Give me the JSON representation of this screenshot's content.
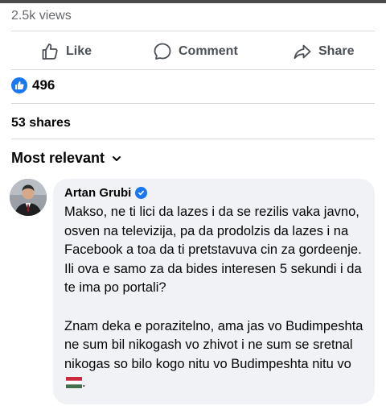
{
  "post": {
    "views": "2.5k views",
    "actions": {
      "like_label": "Like",
      "comment_label": "Comment",
      "share_label": "Share"
    },
    "reactions": {
      "icon": "like-icon",
      "count": "496"
    },
    "shares": "53 shares"
  },
  "comments": {
    "sort_label": "Most relevant",
    "items": [
      {
        "author": "Artan Grubi",
        "verified": true,
        "paragraphs": [
          "Makso, ne ti lici da lazes i da se rezilis vaka javno, osven na televizija, pa da prodolzis da lazes i na Facebook a toa da ti pretstavuva cin za gordeenje. Ili ova e samo za da bides interesen 5 sekundi i da te ima po portali?",
          "Znam deka e porazitelno, ama jas vo Budimpeshta ne sum bil nikogash vo zhivot i ne sum se sretnal nikogas so bilo kogo nitu vo Budimpeshta nitu vo"
        ],
        "trailing_emoji": "hungary-flag",
        "trailing_text": "."
      }
    ]
  },
  "colors": {
    "accent": "#1877f2",
    "bubble": "#f0f2f5",
    "secondary_text": "#65676b"
  }
}
